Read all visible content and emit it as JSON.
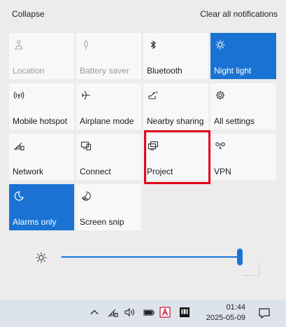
{
  "header": {
    "collapse_label": "Collapse",
    "clear_label": "Clear all notifications"
  },
  "tiles": [
    {
      "label": "Location",
      "icon": "location-icon",
      "state": "off"
    },
    {
      "label": "Battery saver",
      "icon": "battery-saver-icon",
      "state": "off"
    },
    {
      "label": "Bluetooth",
      "icon": "bluetooth-icon",
      "state": "normal"
    },
    {
      "label": "Night light",
      "icon": "night-light-icon",
      "state": "on"
    },
    {
      "label": "Mobile hotspot",
      "icon": "hotspot-icon",
      "state": "normal"
    },
    {
      "label": "Airplane mode",
      "icon": "airplane-icon",
      "state": "normal"
    },
    {
      "label": "Nearby sharing",
      "icon": "nearby-sharing-icon",
      "state": "normal"
    },
    {
      "label": "All settings",
      "icon": "gear-icon",
      "state": "normal"
    },
    {
      "label": "Network",
      "icon": "network-icon",
      "state": "normal"
    },
    {
      "label": "Connect",
      "icon": "connect-icon",
      "state": "normal"
    },
    {
      "label": "Project",
      "icon": "project-icon",
      "state": "normal"
    },
    {
      "label": "VPN",
      "icon": "vpn-icon",
      "state": "normal"
    },
    {
      "label": "Alarms only",
      "icon": "moon-icon",
      "state": "on"
    },
    {
      "label": "Screen snip",
      "icon": "screen-snip-icon",
      "state": "normal"
    }
  ],
  "brightness": {
    "icon": "brightness-icon",
    "level": 1.0
  },
  "taskbar": {
    "time": "01:44",
    "date": "2025-05-09",
    "icons": [
      "chevron-up-icon",
      "wifi-icon",
      "volume-icon",
      "battery-icon",
      "ime-icon",
      "app-icon"
    ]
  },
  "colors": {
    "accent": "#1a73d3",
    "highlight": "#e1001a"
  }
}
